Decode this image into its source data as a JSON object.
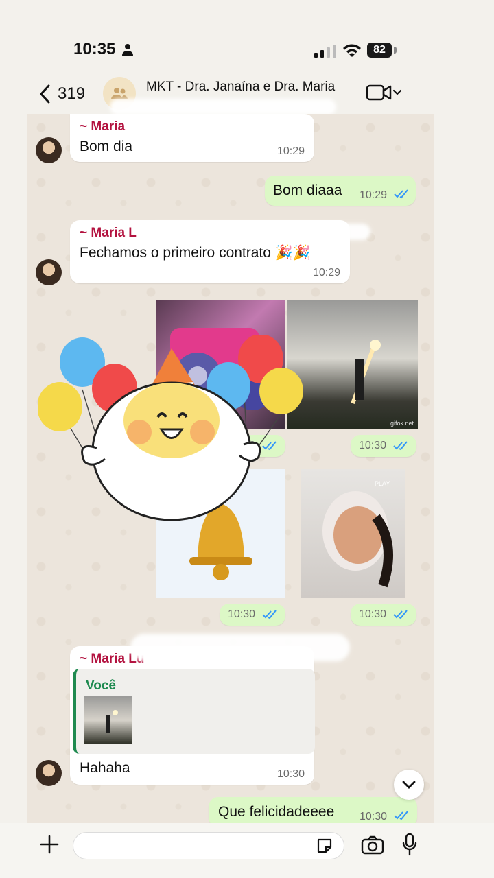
{
  "status_bar": {
    "time": "10:35",
    "battery": "82"
  },
  "header": {
    "back_count": "319",
    "title": "MKT - Dra. Janaína e Dra. Maria"
  },
  "messages": {
    "m1": {
      "sender": "~ Maria",
      "text": "Bom dia",
      "time": "10:29"
    },
    "m2": {
      "text": "Bom diaaa",
      "time": "10:29"
    },
    "m3": {
      "sender": "~ Maria L",
      "text": "Fechamos o primeiro contrato 🎉🎉",
      "time": "10:29"
    },
    "img_row1": {
      "time_left": "10:30",
      "time_right": "10:30",
      "watermark": "gifok.net"
    },
    "img_row2": {
      "time_left": "10:30",
      "time_right": "10:30",
      "play_label": "PLAY"
    },
    "m4": {
      "sender": "~ Maria Lu",
      "reply_author": "Você",
      "text": "Hahaha",
      "time": "10:30"
    },
    "m5": {
      "text": "Que felicidadeeee",
      "time": "10:30"
    }
  },
  "composer": {
    "placeholder": ""
  },
  "icons": {
    "back": "chevron-left-icon",
    "video": "video-camera-icon",
    "plus": "plus-icon",
    "sticker": "sticker-icon",
    "camera": "camera-icon",
    "mic": "microphone-icon",
    "scroll_down": "chevron-down-icon",
    "read_ticks": "double-check-icon"
  },
  "colors": {
    "sender_name": "#b3123f",
    "outgoing_bubble": "#dcf8c6",
    "read_ticks": "#3497f9",
    "reply_bar": "#1f8a50"
  }
}
